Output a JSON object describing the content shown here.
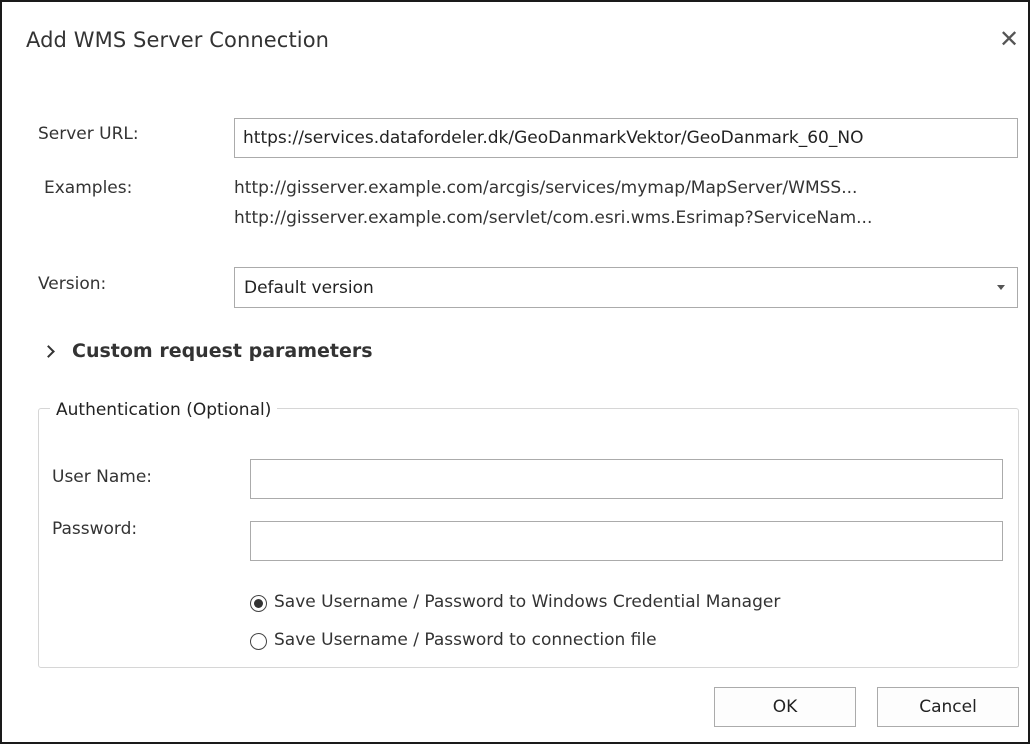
{
  "dialog": {
    "title": "Add WMS Server Connection",
    "close_icon": "close-icon"
  },
  "server_url": {
    "label": "Server URL:",
    "value": "https://services.datafordeler.dk/GeoDanmarkVektor/GeoDanmark_60_NO"
  },
  "examples": {
    "label": "Examples:",
    "items": [
      "http://gisserver.example.com/arcgis/services/mymap/MapServer/WMSS...",
      "http://gisserver.example.com/servlet/com.esri.wms.Esrimap?ServiceNam..."
    ]
  },
  "version": {
    "label": "Version:",
    "selected": "Default version"
  },
  "custom_params": {
    "label": "Custom request parameters",
    "expanded": false
  },
  "authentication": {
    "legend": "Authentication (Optional)",
    "username_label": "User Name:",
    "username_value": "",
    "password_label": "Password:",
    "password_value": "",
    "options": [
      {
        "label": "Save Username / Password to Windows Credential Manager",
        "checked": true
      },
      {
        "label": "Save Username / Password to connection file",
        "checked": false
      }
    ]
  },
  "buttons": {
    "ok": "OK",
    "cancel": "Cancel"
  }
}
